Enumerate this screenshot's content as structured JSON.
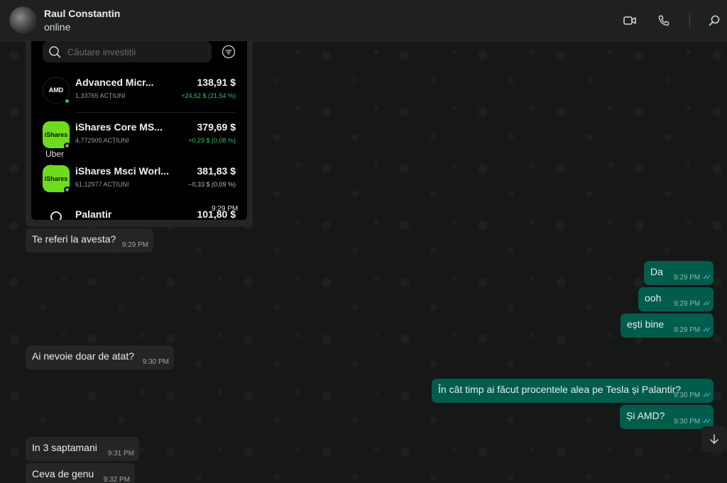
{
  "header": {
    "contact_name": "Raul Constantin",
    "status": "online",
    "icons": [
      "video-call-icon",
      "voice-call-icon",
      "search-icon"
    ]
  },
  "image_message": {
    "search_placeholder": "Căutare investiții",
    "holdings": [
      {
        "logo_text": "AMD",
        "name": "Advanced Micr...",
        "shares": "1,33765 ACȚIUNI",
        "price": "138,91 $",
        "change": "+24,62 $ (21,54 %)",
        "change_color": "#2fbf71"
      },
      {
        "logo_text": "iShares",
        "name": "iShares Core MS...",
        "shares": "4,772905 ACȚIUNI",
        "price": "379,69 $",
        "change": "+0,29 $ (0,08 %)",
        "change_color": "#2fbf71"
      },
      {
        "logo_text": "iShares",
        "name": "iShares Msci Worl...",
        "shares": "61,12977 ACȚIUNI",
        "price": "381,83 $",
        "change": "−0,33 $ (0,09 %)",
        "change_color": "#bdbdbd"
      },
      {
        "logo_text": "",
        "name": "Palantir",
        "shares": "",
        "price": "101,80 $",
        "change": "",
        "change_color": "#bdbdbd"
      }
    ],
    "overlay_label": "Uber",
    "overlay_arrow": "→",
    "time": "9:29 PM"
  },
  "messages": [
    {
      "id": "m1",
      "direction": "in",
      "text": "Te referi la avesta?",
      "time": "9:29 PM"
    },
    {
      "id": "m2",
      "direction": "out",
      "text": "Da",
      "time": "9:29 PM"
    },
    {
      "id": "m3",
      "direction": "out",
      "text": "ooh",
      "time": "9:29 PM"
    },
    {
      "id": "m4",
      "direction": "out",
      "text": "ești bine",
      "time": "9:29 PM"
    },
    {
      "id": "m5",
      "direction": "in",
      "text": "Ai nevoie doar de atat?",
      "time": "9:30 PM"
    },
    {
      "id": "m6",
      "direction": "out",
      "text": "În cât timp ai făcut procentele alea pe Tesla și Palantir?",
      "time": "9:30 PM"
    },
    {
      "id": "m7",
      "direction": "out",
      "text": "Și AMD?",
      "time": "9:30 PM"
    },
    {
      "id": "m8",
      "direction": "in",
      "text": "In 3 saptamani",
      "time": "9:31 PM"
    },
    {
      "id": "m9",
      "direction": "in",
      "text": "Ceva de genu",
      "time": "9:32 PM"
    }
  ],
  "colors": {
    "incoming_bubble": "#242626",
    "outgoing_bubble": "#005c4b",
    "read_ticks": "#53bdeb"
  }
}
